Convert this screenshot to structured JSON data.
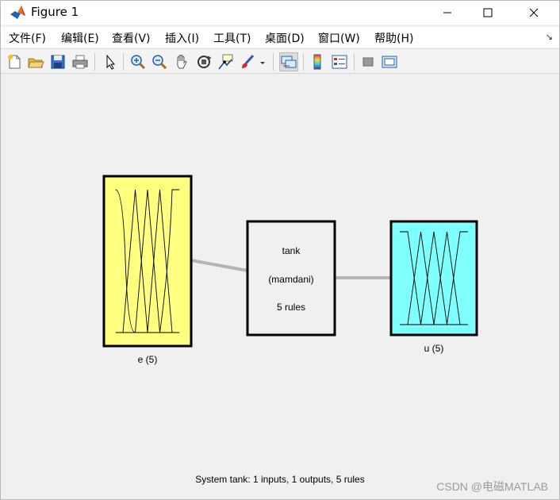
{
  "window": {
    "title": "Figure 1",
    "controls": [
      "minimize-icon",
      "maximize-icon",
      "close-icon"
    ]
  },
  "menubar": {
    "items": [
      "文件(F)",
      "编辑(E)",
      "查看(V)",
      "插入(I)",
      "工具(T)",
      "桌面(D)",
      "窗口(W)",
      "帮助(H)"
    ],
    "overflow": "↘"
  },
  "toolbar": {
    "buttons": [
      "new-figure-icon",
      "open-icon",
      "save-icon",
      "print-icon",
      "pointer-icon",
      "zoom-in-icon",
      "zoom-out-icon",
      "pan-hand-icon",
      "rotate-3d-icon",
      "data-cursor-icon",
      "brush-icon",
      "brush-dropdown-icon",
      "link-plot-icon",
      "colorbar-icon",
      "legend-icon",
      "hide-plot-tools-icon",
      "show-plot-tools-icon"
    ]
  },
  "fis": {
    "input": {
      "label": "e (5)",
      "color": "#ffff80",
      "mf_count": 5
    },
    "system": {
      "name": "tank",
      "type": "(mamdani)",
      "rules": "5 rules"
    },
    "output": {
      "label": "u (5)",
      "color": "#80ffff",
      "mf_count": 5
    },
    "connector_color": "#b4b4b4"
  },
  "status": "System tank: 1 inputs, 1 outputs, 5 rules",
  "watermark": "CSDN @电磁MATLAB"
}
